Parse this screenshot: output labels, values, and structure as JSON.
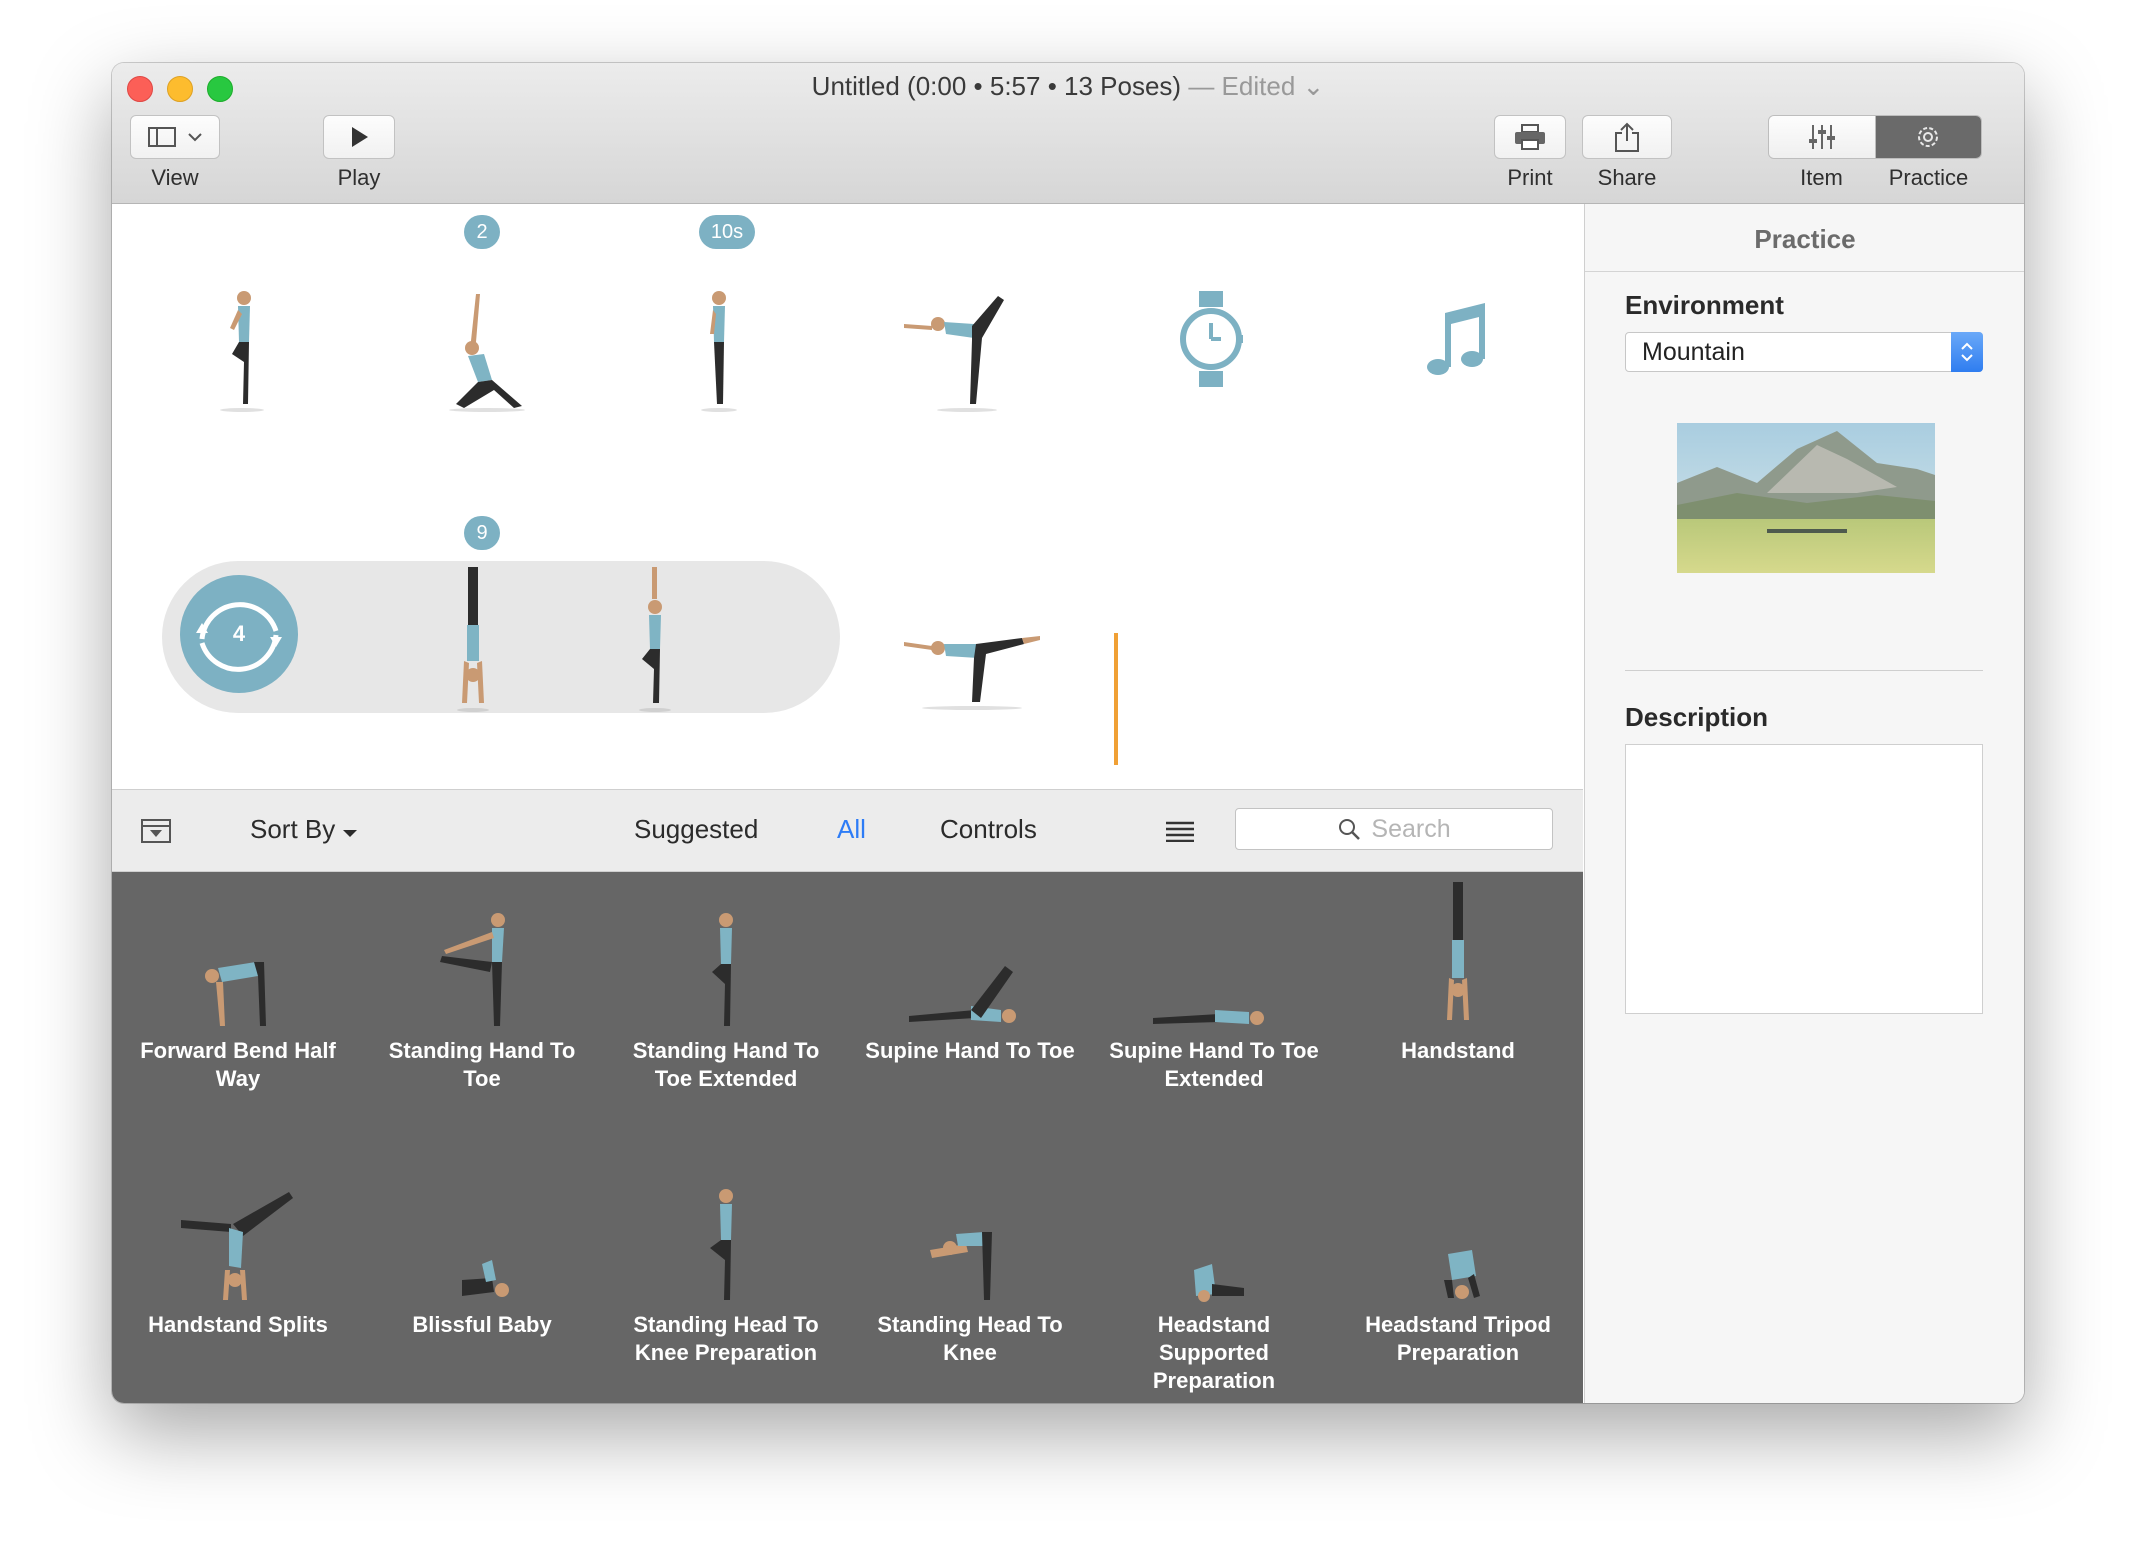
{
  "window": {
    "title_main": "Untitled (0:00  • 5:57  •  13 Poses)",
    "title_edited": "— Edited",
    "title_chevron": "⌄"
  },
  "toolbar": {
    "view_label": "View",
    "play_label": "Play",
    "print_label": "Print",
    "share_label": "Share",
    "item_label": "Item",
    "practice_label": "Practice"
  },
  "timeline": {
    "badges": [
      "2",
      "10s",
      "9"
    ],
    "loop_count": "4",
    "poses": [
      "pose-1",
      "pose-2",
      "pose-3",
      "pose-4",
      "timer",
      "music",
      "pose-7",
      "pose-8",
      "pose-9"
    ]
  },
  "library_toolbar": {
    "sort_label": "Sort By",
    "tabs": [
      "Suggested",
      "All",
      "Controls"
    ],
    "active_tab": "All",
    "search_placeholder": "Search",
    "accent_color": "#2d7cf6"
  },
  "library": {
    "items": [
      {
        "label": "Forward Bend Half Way"
      },
      {
        "label": "Standing Hand To Toe"
      },
      {
        "label": "Standing Hand To Toe Extended"
      },
      {
        "label": "Supine Hand To Toe"
      },
      {
        "label": "Supine Hand To Toe Extended"
      },
      {
        "label": "Handstand"
      },
      {
        "label": "Handstand Splits"
      },
      {
        "label": "Blissful Baby"
      },
      {
        "label": "Standing Head To Knee Preparation"
      },
      {
        "label": "Standing Head To Knee"
      },
      {
        "label": "Headstand Supported Preparation"
      },
      {
        "label": "Headstand Tripod Preparation"
      }
    ]
  },
  "inspector": {
    "title": "Practice",
    "environment_label": "Environment",
    "environment_value": "Mountain",
    "description_label": "Description",
    "description_value": ""
  },
  "colors": {
    "badge": "#7db1c3",
    "cursor": "#f0a035",
    "library_bg": "#666666"
  }
}
